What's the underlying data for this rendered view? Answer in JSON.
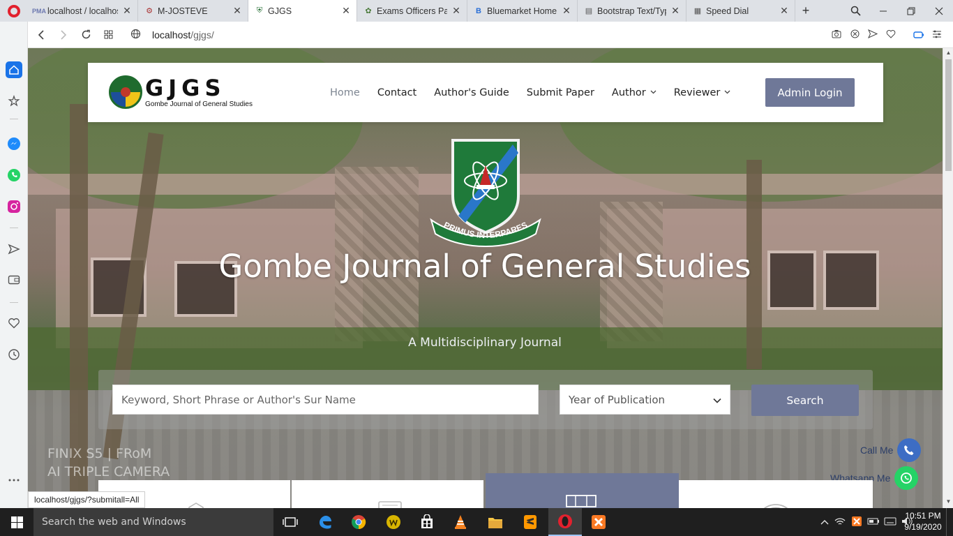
{
  "browser": {
    "tabs": [
      {
        "title": "localhost / localhost",
        "favicon": "phpmyadmin-icon",
        "active": false
      },
      {
        "title": "M-JOSTEVE",
        "favicon": "site-icon",
        "active": false
      },
      {
        "title": "GJGS",
        "favicon": "gjgs-icon",
        "active": true
      },
      {
        "title": "Exams Officers Page",
        "favicon": "site-icon",
        "active": false
      },
      {
        "title": "Bluemarket Home",
        "favicon": "bluemarket-icon",
        "active": false
      },
      {
        "title": "Bootstrap Text/Typo",
        "favicon": "document-icon",
        "active": false
      },
      {
        "title": "Speed Dial",
        "favicon": "grid-icon",
        "active": false
      }
    ],
    "close_glyph": "✕",
    "new_tab_glyph": "+",
    "url_host": "localhost",
    "url_path": "/gjgs/",
    "status_url": "localhost/gjgs/?submitall=All"
  },
  "site": {
    "brand_name": "GJGS",
    "brand_tagline": "Gombe Journal of General Studies",
    "nav": [
      {
        "label": "Home",
        "active": true,
        "dropdown": false
      },
      {
        "label": "Contact",
        "active": false,
        "dropdown": false
      },
      {
        "label": "Author's Guide",
        "active": false,
        "dropdown": false
      },
      {
        "label": "Submit Paper",
        "active": false,
        "dropdown": false
      },
      {
        "label": "Author",
        "active": false,
        "dropdown": true
      },
      {
        "label": "Reviewer",
        "active": false,
        "dropdown": true
      }
    ],
    "admin_login_label": "Admin Login",
    "crest_motto": "PRIMUS INTERPARES",
    "hero_title": "Gombe Journal of General Studies",
    "hero_subtitle": "A Multidisciplinary Journal",
    "search": {
      "keyword_placeholder": "Keyword, Short Phrase or Author's Sur Name",
      "year_placeholder": "Year of Publication",
      "button_label": "Search"
    },
    "watermark_line1": "FINIX S5 | FRoM",
    "watermark_line2": "AI TRIPLE CAMERA",
    "contacts": {
      "call_label": "Call Me",
      "whatsapp_label": "Whatsapp Me"
    },
    "accent_color": "#6f7898"
  },
  "taskbar": {
    "search_placeholder": "Search the web and Windows",
    "time": "10:51 PM",
    "date": "9/19/2020"
  }
}
